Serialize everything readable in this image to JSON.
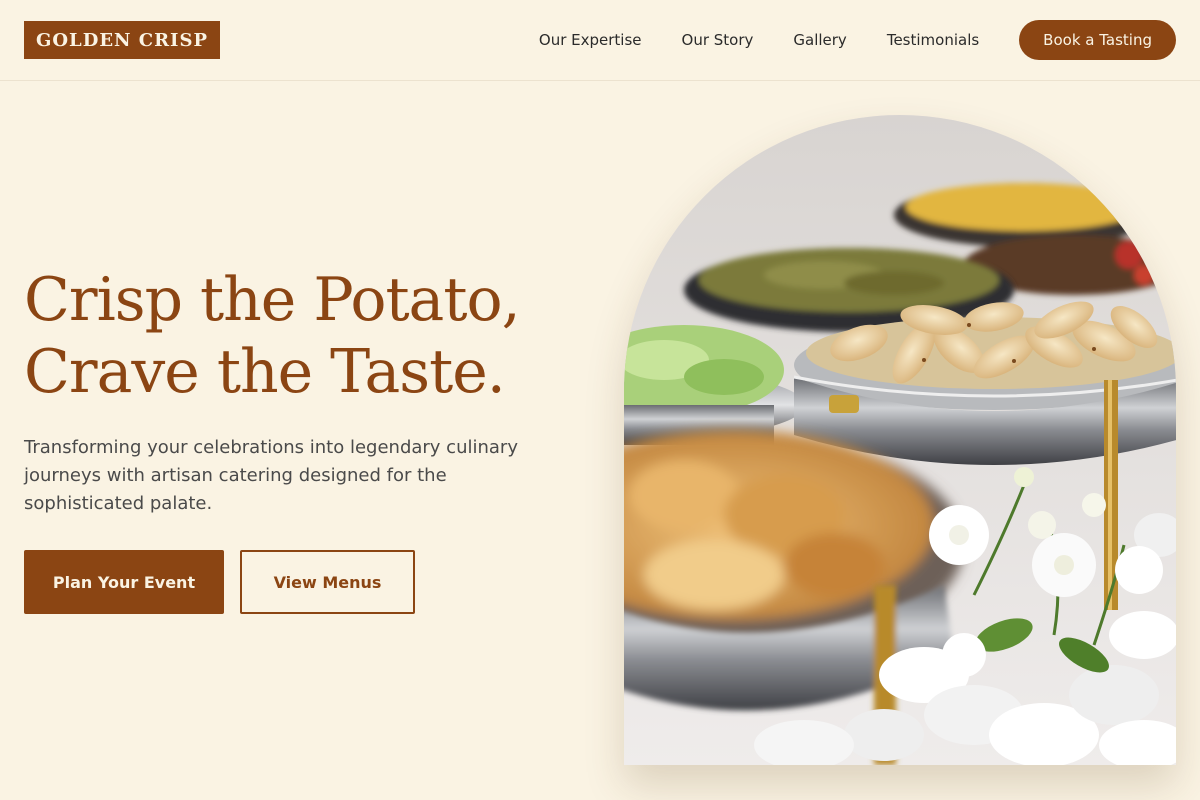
{
  "header": {
    "logo_text": "GOLDEN CRISP",
    "nav": [
      {
        "label": "Our Expertise"
      },
      {
        "label": "Our Story"
      },
      {
        "label": "Gallery"
      },
      {
        "label": "Testimonials"
      }
    ],
    "cta_label": "Book a Tasting"
  },
  "hero": {
    "headline_line1": "Crisp the Potato,",
    "headline_line2": "Crave the Taste.",
    "subtitle": "Transforming your celebrations into legendary culinary journeys with artisan catering designed for the sophisticated palate.",
    "primary_button": "Plan Your Event",
    "secondary_button": "View Menus"
  },
  "colors": {
    "background": "#FAF3E3",
    "accent": "#8B4513",
    "text": "#2B2B2B"
  }
}
